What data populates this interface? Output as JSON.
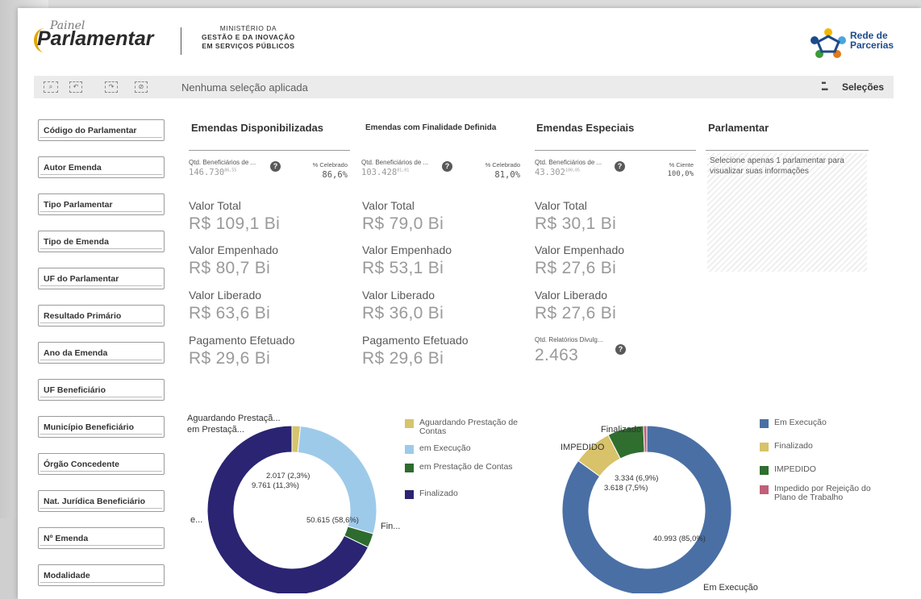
{
  "header": {
    "logo_top": "Painel",
    "logo_main": "Parlamentar",
    "ministry_line1": "MINISTÉRIO DA",
    "ministry_line2": "GESTÃO E DA INOVAÇÃO",
    "ministry_line3": "EM SERVIÇOS PÚBLICOS",
    "partner_line1": "Rede de",
    "partner_line2": "Parcerias"
  },
  "toolbar": {
    "selection_text": "Nenhuma seleção aplicada",
    "selections_label": "Seleções"
  },
  "filters": [
    "Código do Parlamentar",
    "Autor Emenda",
    "Tipo Parlamentar",
    "Tipo de Emenda",
    "UF do Parlamentar",
    "Resultado Primário",
    "Ano da Emenda",
    "UF Beneficiário",
    "Município Beneficiário",
    "Órgão Concedente",
    "Nat. Jurídica Beneficiário",
    "Nº Emenda",
    "Modalidade"
  ],
  "columns": {
    "disponibilizadas": {
      "title": "Emendas Disponibilizadas",
      "qtd_label": "Qtd. Beneficiários de ...",
      "qtd_value": "146.730",
      "qtd_sup": "86,55",
      "pct_label": "% Celebrado",
      "pct_value": "86,6%",
      "total_label": "Valor Total",
      "total": "R$ 109,1 Bi",
      "empenhado_label": "Valor Empenhado",
      "empenhado": "R$ 80,7 Bi",
      "liberado_label": "Valor Liberado",
      "liberado": "R$ 63,6 Bi",
      "pagamento_label": "Pagamento Efetuado",
      "pagamento": "R$ 29,6 Bi"
    },
    "finalidade": {
      "title": "Emendas com Finalidade Definida",
      "qtd_label": "Qtd. Beneficiários de ...",
      "qtd_value": "103.428",
      "qtd_sup": "81,01",
      "pct_label": "% Celebrado",
      "pct_value": "81,0%",
      "total_label": "Valor Total",
      "total": "R$ 79,0 Bi",
      "empenhado_label": "Valor Empenhado",
      "empenhado": "R$ 53,1 Bi",
      "liberado_label": "Valor Liberado",
      "liberado": "R$ 36,0 Bi",
      "pagamento_label": "Pagamento Efetuado",
      "pagamento": "R$ 29,6 Bi"
    },
    "especiais": {
      "title": "Emendas Especiais",
      "qtd_label": "Qtd. Beneficiários de ...",
      "qtd_value": "43.302",
      "qtd_sup": "100,05",
      "pct_label": "% Ciente",
      "pct_value": "100,0%",
      "total_label": "Valor Total",
      "total": "R$ 30,1 Bi",
      "empenhado_label": "Valor Empenhado",
      "empenhado": "R$ 27,6 Bi",
      "liberado_label": "Valor Liberado",
      "liberado": "R$ 27,6 Bi",
      "relatorios_label": "Qtd. Relatórios Divulg...",
      "relatorios": "2.463"
    },
    "parlamentar": {
      "title": "Parlamentar",
      "message": "Selecione apenas 1 parlamentar para visualizar suas informações"
    }
  },
  "chart_data": [
    {
      "type": "pie",
      "donut": true,
      "categories": [
        "Aguardando Prestação de Contas",
        "em Execução",
        "em Prestação de Contas",
        "Finalizado"
      ],
      "colors": [
        "#d7c46c",
        "#9ecae9",
        "#2e6b2e",
        "#2a2472"
      ],
      "values": [
        1200,
        20800,
        2017,
        50615
      ],
      "data_labels": [
        "",
        "",
        "2.017 (2,3%)",
        "50.615 (58,6%)"
      ],
      "extra_labels": [
        "9.761 (11,3%)"
      ],
      "outer_labels": [
        "Aguardando Prestaçã...",
        "em Prestaçã...",
        "e...",
        "Fin..."
      ],
      "legend": [
        "Aguardando Prestação de Contas",
        "em Execução",
        "em Prestação de Contas",
        "Finalizado"
      ],
      "legend_position": "right"
    },
    {
      "type": "pie",
      "donut": true,
      "categories": [
        "Em Execução",
        "Finalizado",
        "IMPEDIDO",
        "Impedido por Rejeição do Plano de Trabalho"
      ],
      "colors": [
        "#4a6fa5",
        "#d8c26a",
        "#2f6e2f",
        "#c0607a"
      ],
      "values": [
        40993,
        3618,
        3334,
        300
      ],
      "data_labels": [
        "40.993 (85,0%)",
        "3.618 (7,5%)",
        "3.334 (6,9%)",
        ""
      ],
      "outer_labels": [
        "Em Execução",
        "Finalizado",
        "IMPEDIDO"
      ],
      "legend": [
        "Em Execução",
        "Finalizado",
        "IMPEDIDO",
        "Impedido por Rejeição do Plano de Trabalho"
      ],
      "legend_position": "right"
    }
  ]
}
